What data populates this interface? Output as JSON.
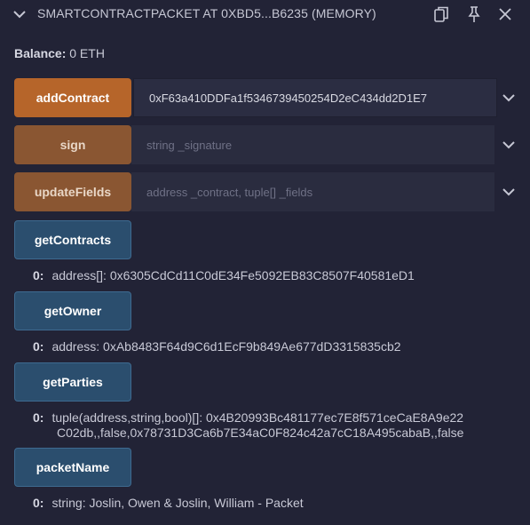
{
  "header": {
    "title": "SMARTCONTRACTPACKET AT 0XBD5...B6235 (MEMORY)",
    "icons": [
      "chevron-down-icon",
      "copy-icon",
      "pin-icon",
      "close-icon"
    ]
  },
  "balance": {
    "label": "Balance:",
    "value": "0 ETH"
  },
  "functions": {
    "addContract": {
      "label": "addContract",
      "value": "0xF63a410DDFa1f5346739450254D2eC434dd2D1E7",
      "placeholder": ""
    },
    "sign": {
      "label": "sign",
      "placeholder": "string _signature"
    },
    "updateFields": {
      "label": "updateFields",
      "placeholder": "address _contract, tuple[] _fields"
    },
    "getContracts": {
      "label": "getContracts",
      "out_index": "0:",
      "out_text": "address[]: 0x6305CdCd11C0dE34Fe5092EB83C8507F40581eD1"
    },
    "getOwner": {
      "label": "getOwner",
      "out_index": "0:",
      "out_text": "address: 0xAb8483F64d9C6d1EcF9b849Ae677dD3315835cb2"
    },
    "getParties": {
      "label": "getParties",
      "out_index": "0:",
      "out_line1": "tuple(address,string,bool)[]: 0x4B20993Bc481177ec7E8f571ceCaE8A9e22",
      "out_line2": "C02db,,false,0x78731D3Ca6b7E34aC0F824c42a7cC18A495cabaB,,false"
    },
    "packetName": {
      "label": "packetName",
      "out_index": "0:",
      "out_text": "string: Joslin, Owen & Joslin, William - Packet"
    }
  },
  "colors": {
    "background": "#222336",
    "transact_button": "#b6652a",
    "call_button": "#2b4e6e",
    "input_bg": "#2a2c3f"
  }
}
